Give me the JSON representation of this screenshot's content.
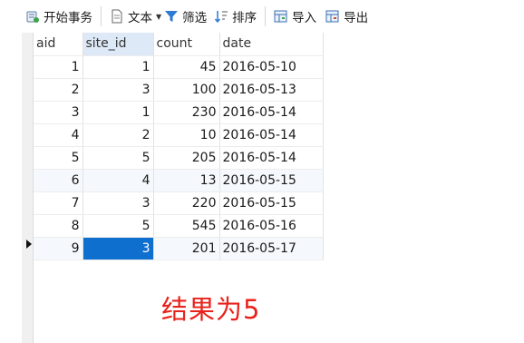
{
  "toolbar": {
    "begin_transaction": "开始事务",
    "text": "文本",
    "filter": "筛选",
    "sort": "排序",
    "import": "导入",
    "export": "导出"
  },
  "table": {
    "columns": [
      "aid",
      "site_id",
      "count",
      "date"
    ],
    "selected_column": "site_id",
    "rows": [
      {
        "aid": "1",
        "site_id": "1",
        "count": "45",
        "date": "2016-05-10"
      },
      {
        "aid": "2",
        "site_id": "3",
        "count": "100",
        "date": "2016-05-13"
      },
      {
        "aid": "3",
        "site_id": "1",
        "count": "230",
        "date": "2016-05-14"
      },
      {
        "aid": "4",
        "site_id": "2",
        "count": "10",
        "date": "2016-05-14"
      },
      {
        "aid": "5",
        "site_id": "5",
        "count": "205",
        "date": "2016-05-14"
      },
      {
        "aid": "6",
        "site_id": "4",
        "count": "13",
        "date": "2016-05-15"
      },
      {
        "aid": "7",
        "site_id": "3",
        "count": "220",
        "date": "2016-05-15"
      },
      {
        "aid": "8",
        "site_id": "5",
        "count": "545",
        "date": "2016-05-16"
      },
      {
        "aid": "9",
        "site_id": "3",
        "count": "201",
        "date": "2016-05-17"
      }
    ],
    "current_row": 9
  },
  "annotation": "结果为5",
  "colors": {
    "selected_cell": "#0f6fcf",
    "annotation": "#e8231c",
    "header_selected": "#dde9f6"
  }
}
